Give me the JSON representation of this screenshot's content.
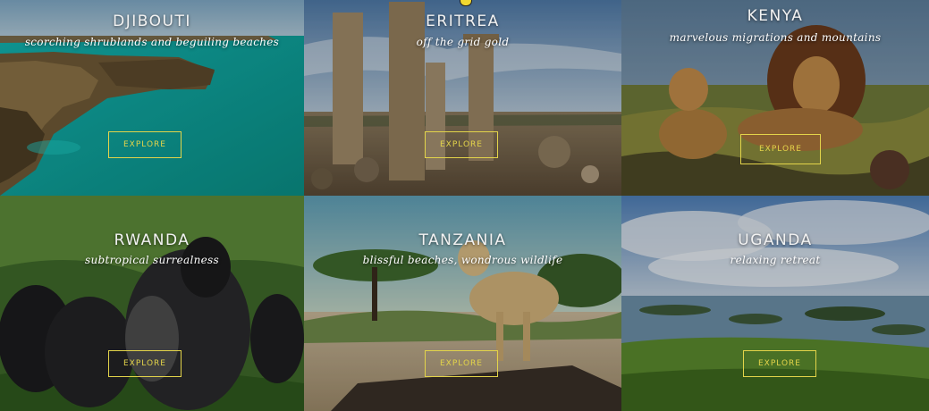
{
  "destinations": [
    {
      "name": "DJIBOUTI",
      "tagline": "scorching shrublands and beguiling beaches",
      "button": "EXPLORE"
    },
    {
      "name": "ERITREA",
      "tagline": "off the grid gold",
      "button": "EXPLORE"
    },
    {
      "name": "KENYA",
      "tagline": "marvelous migrations and mountains",
      "button": "EXPLORE"
    },
    {
      "name": "RWANDA",
      "tagline": "subtropical surrealness",
      "button": "EXPLORE"
    },
    {
      "name": "TANZANIA",
      "tagline": "blissful beaches, wondrous wildlife",
      "button": "EXPLORE"
    },
    {
      "name": "UGANDA",
      "tagline": "relaxing retreat",
      "button": "EXPLORE"
    }
  ],
  "colors": {
    "button_border": "#e3d44a",
    "title_text": "#f2f2f2"
  }
}
